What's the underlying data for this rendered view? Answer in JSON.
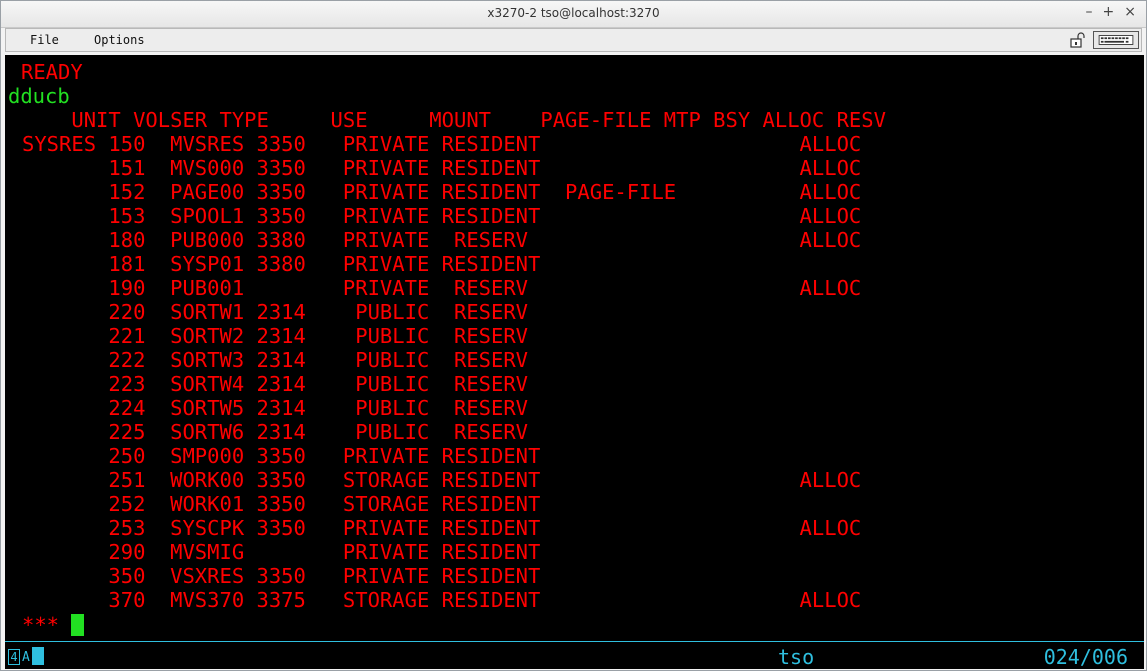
{
  "window": {
    "title": "x3270-2 tso@localhost:3270",
    "buttons": [
      "–",
      "+",
      "×"
    ]
  },
  "menu": {
    "file": "File",
    "options": "Options"
  },
  "terminal": {
    "status": "READY",
    "command": "dducb",
    "header": "    UNIT VOLSER TYPE     USE     MOUNT    PAGE-FILE MTP BSY ALLOC RESV",
    "rows": [
      "SYSRES 150  MVSRES 3350   PRIVATE RESIDENT                     ALLOC",
      "       151  MVS000 3350   PRIVATE RESIDENT                     ALLOC",
      "       152  PAGE00 3350   PRIVATE RESIDENT  PAGE-FILE          ALLOC",
      "       153  SPOOL1 3350   PRIVATE RESIDENT                     ALLOC",
      "       180  PUB000 3380   PRIVATE  RESERV                      ALLOC",
      "       181  SYSP01 3380   PRIVATE RESIDENT",
      "       190  PUB001        PRIVATE  RESERV                      ALLOC",
      "       220  SORTW1 2314    PUBLIC  RESERV",
      "       221  SORTW2 2314    PUBLIC  RESERV",
      "       222  SORTW3 2314    PUBLIC  RESERV",
      "       223  SORTW4 2314    PUBLIC  RESERV",
      "       224  SORTW5 2314    PUBLIC  RESERV",
      "       225  SORTW6 2314    PUBLIC  RESERV",
      "       250  SMP000 3350   PRIVATE RESIDENT",
      "       251  WORK00 3350   STORAGE RESIDENT                     ALLOC",
      "       252  WORK01 3350   STORAGE RESIDENT",
      "       253  SYSCPK 3350   PRIVATE RESIDENT                     ALLOC",
      "       290  MVSMIG        PRIVATE RESIDENT",
      "       350  VSXRES 3350   PRIVATE RESIDENT",
      "       370  MVS370 3375   STORAGE RESIDENT                     ALLOC"
    ],
    "prompt": "***"
  },
  "oia": {
    "indicator": "4",
    "lock_glyph": "A",
    "user": "tso",
    "cursor_pos": "024/006"
  }
}
